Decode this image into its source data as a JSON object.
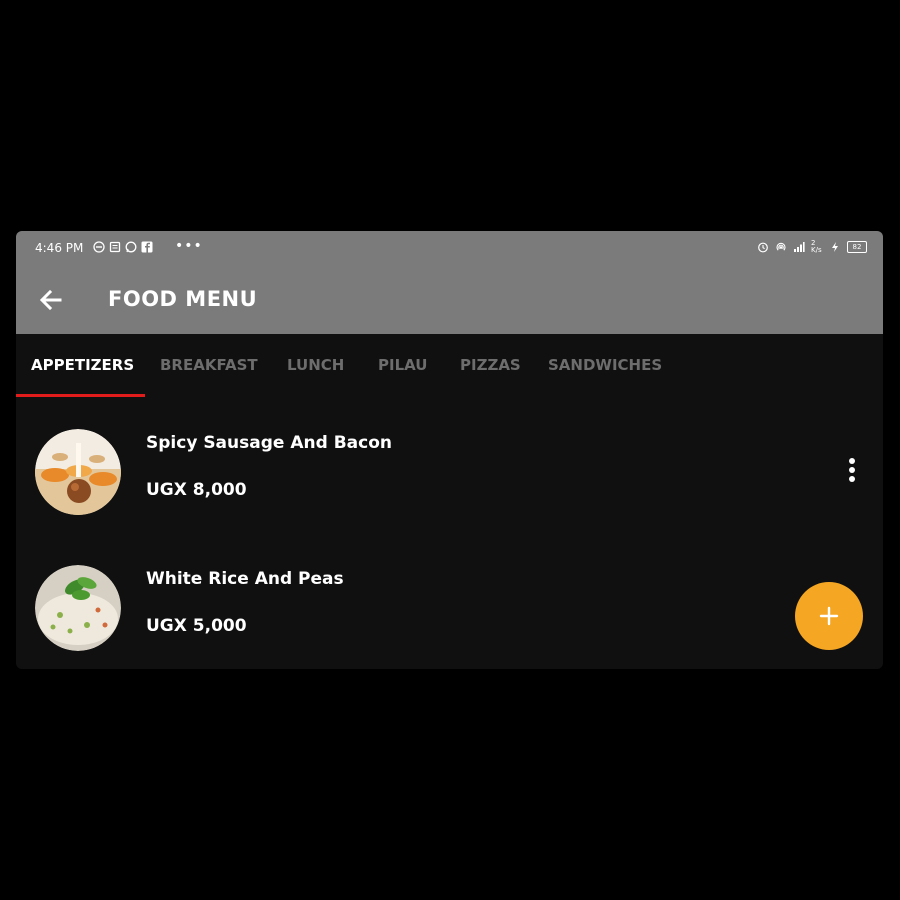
{
  "status_bar": {
    "time": "4:46 PM",
    "left_icons": [
      "dnd-icon",
      "notes-icon",
      "whatsapp-icon",
      "facebook-icon"
    ],
    "overflow": "•••",
    "right_icons": [
      "alarm-icon",
      "hotspot-icon",
      "signal-icon",
      "speed-icon",
      "charging-icon",
      "battery-icon"
    ],
    "speed": "2 K/s",
    "battery": "82"
  },
  "header": {
    "title": "FOOD MENU",
    "back_icon": "arrow-left-icon"
  },
  "tabs": [
    {
      "label": "APPETIZERS",
      "active": true
    },
    {
      "label": "BREAKFAST",
      "active": false
    },
    {
      "label": "LUNCH",
      "active": false
    },
    {
      "label": "PILAU",
      "active": false
    },
    {
      "label": "PIZZAS",
      "active": false
    },
    {
      "label": "SANDWICHES",
      "active": false
    }
  ],
  "items": [
    {
      "name": "Spicy Sausage And Bacon",
      "price": "UGX 8,000"
    },
    {
      "name": "White Rice And Peas",
      "price": "UGX 5,000"
    }
  ],
  "fab": {
    "icon": "plus-icon"
  },
  "colors": {
    "app_bar": "#7b7b7b",
    "background": "#101010",
    "tab_indicator": "#e21b1b",
    "fab": "#f5a623",
    "inactive_tab": "#6d6d6d"
  }
}
